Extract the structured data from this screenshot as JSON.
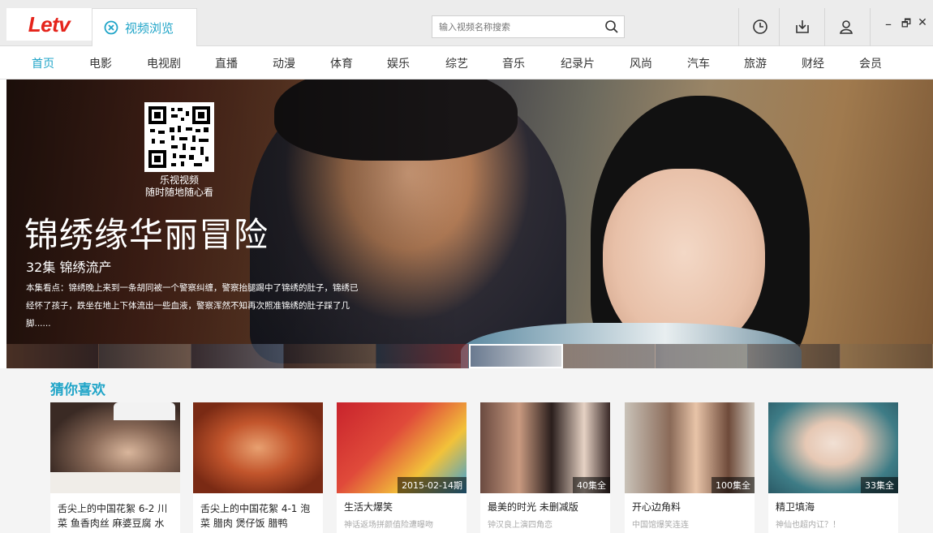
{
  "app": {
    "logo": "Letv",
    "tab_label": "视频浏览"
  },
  "search": {
    "placeholder": "输入视频名称搜索"
  },
  "window_controls": {
    "minimize": "–",
    "restore": "🗗",
    "close": "✕"
  },
  "nav": {
    "items": [
      "首页",
      "电影",
      "电视剧",
      "直播",
      "动漫",
      "体育",
      "娱乐",
      "综艺",
      "音乐",
      "纪录片",
      "风尚",
      "汽车",
      "旅游",
      "财经",
      "会员"
    ],
    "active_index": 0
  },
  "hero": {
    "qr_caption_line1": "乐视视频",
    "qr_caption_line2": "随时随地随心看",
    "title": "锦绣缘华丽冒险",
    "subtitle": "32集 锦绣流产",
    "description": "本集看点：锦绣晚上来到一条胡同被一个警察纠缠，警察抬腿踢中了锦绣的肚子，锦绣已经怀了孩子，跌坐在地上下体流出一些血液，警察浑然不知再次照准锦绣的肚子踩了几脚......",
    "thumbnails_count": 10,
    "active_thumbnail": 5
  },
  "recommend": {
    "heading": "猜你喜欢",
    "cards": [
      {
        "title": "舌尖上的中国花絮 6-2 川菜 鱼香肉丝 麻婆豆腐 水",
        "desc": "",
        "badge": "",
        "colors": [
          "#3a2a24",
          "#d9cfc4"
        ]
      },
      {
        "title": "舌尖上的中国花絮 4-1 泡菜 腊肉 煲仔饭 腊鸭",
        "desc": "",
        "badge": "",
        "colors": [
          "#9a3a1e",
          "#e6a070"
        ]
      },
      {
        "title": "生活大爆笑",
        "desc": "神话返场拼颜值险遭曝吻",
        "badge": "2015-02-14期",
        "colors": [
          "#c8232c",
          "#f2c23a"
        ]
      },
      {
        "title": "最美的时光 未删减版",
        "desc": "钟汉良上演四角恋",
        "badge": "40集全",
        "colors": [
          "#4a3a36",
          "#e6d2c4"
        ]
      },
      {
        "title": "开心边角料",
        "desc": "中国馆爆笑连连",
        "badge": "100集全",
        "colors": [
          "#6e4a3a",
          "#c9c2b8"
        ]
      },
      {
        "title": "精卫填海",
        "desc": "神仙也超内讧？！",
        "badge": "33集全",
        "colors": [
          "#3e7c86",
          "#f1e6da"
        ]
      }
    ]
  }
}
